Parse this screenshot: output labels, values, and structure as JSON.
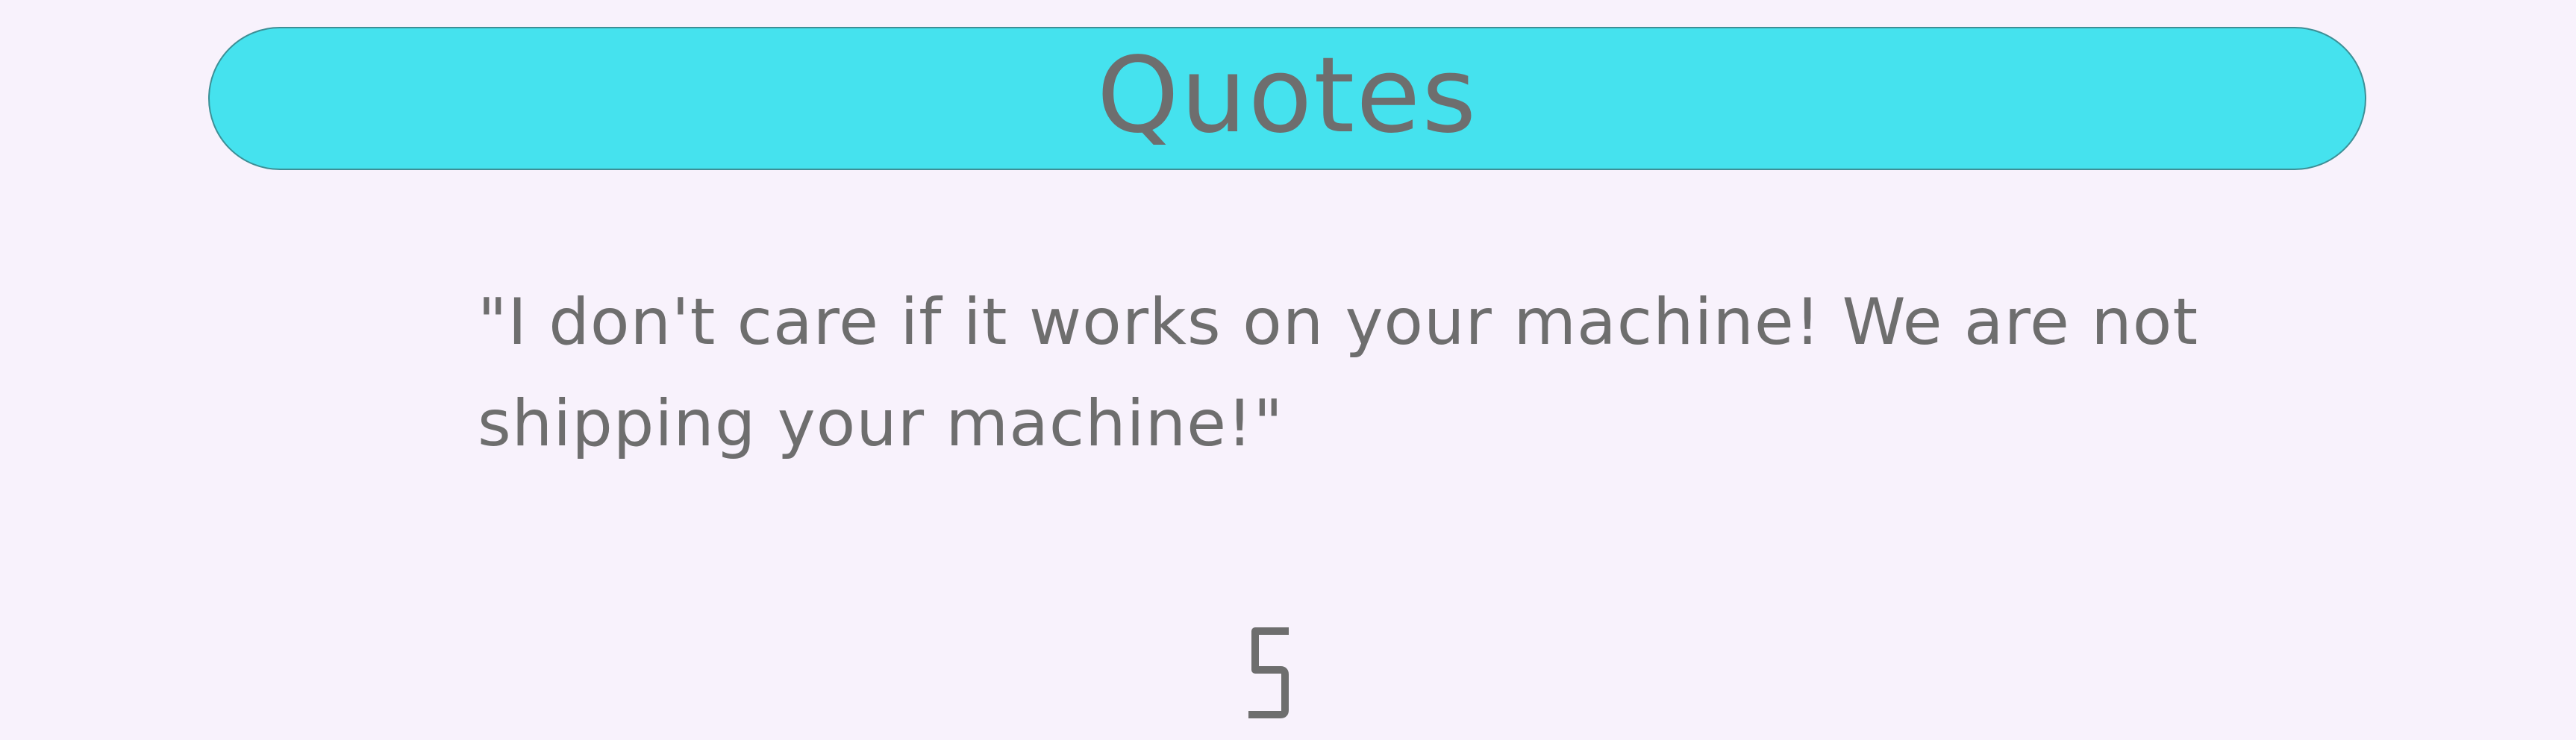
{
  "header": {
    "title": "Quotes",
    "background_color": "#45e2ee"
  },
  "quote": {
    "text": "\"I don't care if it works on your machine! We are not shipping your machine!\""
  },
  "counter": {
    "value": "5"
  },
  "colors": {
    "background": "#f8f2fc",
    "text": "#6e6e6e"
  }
}
